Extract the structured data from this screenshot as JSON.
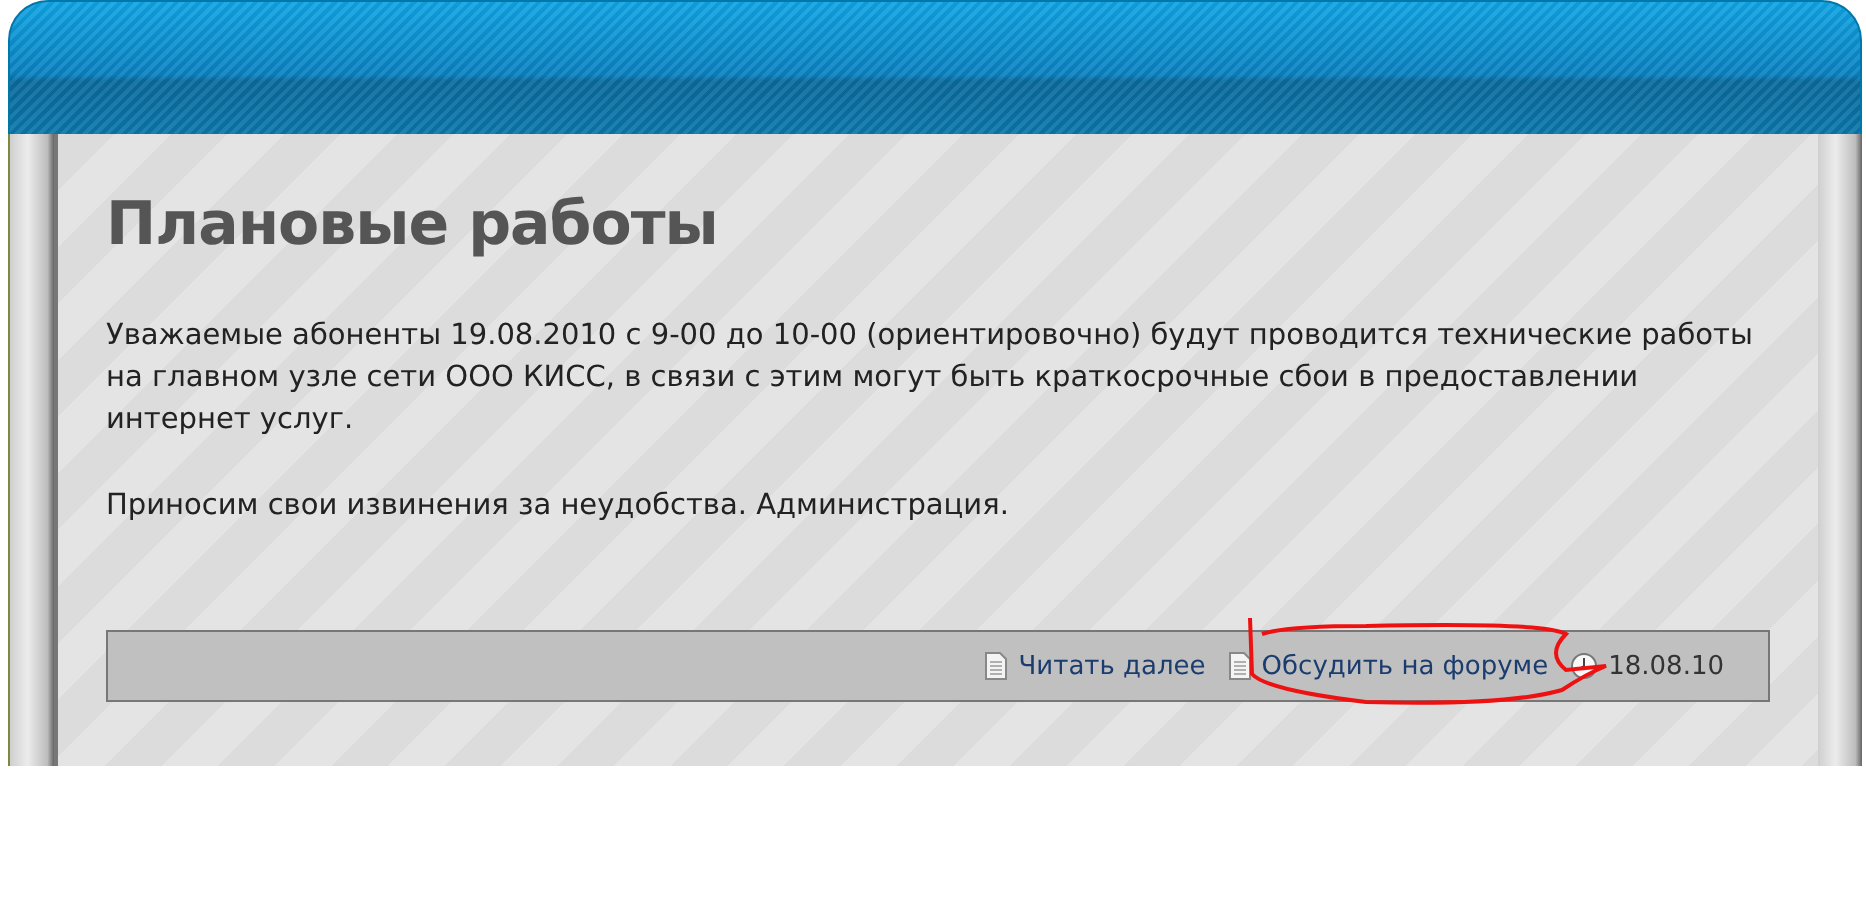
{
  "article": {
    "title": "Плановые работы",
    "paragraphs": [
      "Уважаемые абоненты 19.08.2010 с 9-00 до 10-00 (ориентировочно) будут проводится технические работы на главном узле сети ООО КИСС, в связи с этим могут быть краткосрочные сбои в предоставлении интернет услуг.",
      "Приносим свои извинения за неудобства. Администрация."
    ],
    "footer": {
      "links": [
        "Читать далее",
        "Обсудить на форуме"
      ],
      "date": "18.08.10"
    }
  }
}
